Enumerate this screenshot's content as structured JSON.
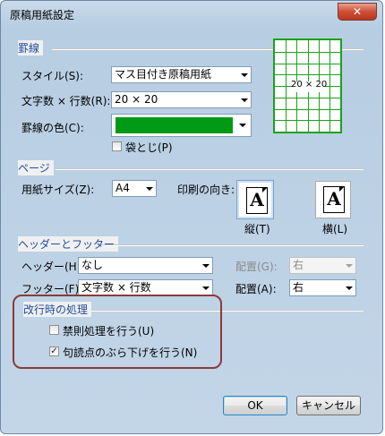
{
  "window": {
    "title": "原稿用紙設定",
    "close_label": "✕"
  },
  "ruled_lines": {
    "group_title": "罫線",
    "style_label": "スタイル(S):",
    "style_value": "マス目付き原稿用紙",
    "chars_lines_label": "文字数 × 行数(R):",
    "chars_lines_value": "20 × 20",
    "line_color_label": "罫線の色(C):",
    "line_color": "#009a17",
    "fold_checkbox_label": "袋とじ(P)",
    "fold_checked": false,
    "preview_text": "20 × 20"
  },
  "page": {
    "group_title": "ページ",
    "paper_size_label": "用紙サイズ(Z):",
    "paper_size_value": "A4",
    "orientation_label": "印刷の向き:",
    "portrait_label": "縦(T)",
    "landscape_label": "横(L)",
    "orientation_icon_glyph": "A",
    "selected_orientation": "portrait"
  },
  "header_footer": {
    "group_title": "ヘッダーとフッター",
    "header_label": "ヘッダー(H):",
    "header_value": "なし",
    "header_align_label": "配置(G):",
    "header_align_value": "右",
    "footer_label": "フッター(F):",
    "footer_value": "文字数 × 行数",
    "footer_align_label": "配置(A):",
    "footer_align_value": "右"
  },
  "line_break": {
    "group_title": "改行時の処理",
    "kinsoku_label": "禁則処理を行う(U)",
    "kinsoku_checked": false,
    "kutouten_label": "句読点のぶら下げを行う(N)",
    "kutouten_checked": true
  },
  "buttons": {
    "ok": "OK",
    "cancel": "キャンセル"
  },
  "colors": {
    "accent": "#1e4c9e",
    "grid_green": "#19a319",
    "highlight": "#8a3b38"
  }
}
